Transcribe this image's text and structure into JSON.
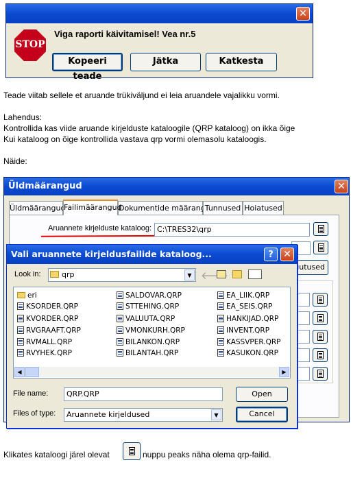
{
  "error_dialog": {
    "stop_sign_text": "STOP",
    "message": "Viga raporti käivitamisel! Vea nr.5",
    "close_symbol": "✕",
    "buttons": [
      "Kopeeri teade",
      "Jätka",
      "Katkesta"
    ]
  },
  "body_text": {
    "line1": "Teade viitab sellele et aruande trükiväljund ei leia aruandele vajalikku vormi.",
    "lahendus_heading": "Lahendus:",
    "lahendus_line1": "Kontrollida kas viide aruande kirjelduste kataloogile (QRP kataloog) on ikka õige",
    "lahendus_line2": "Kui kataloog on õige kontrollida vastava qrp vormi olemasolu kataloogis.",
    "naide": "Näide:",
    "footer_before": "Klikates kataloogi järel olevat",
    "footer_after": "nuppu  peaks näha olema qrp-failid."
  },
  "settings_window": {
    "title": "Üldmäärangud",
    "close_symbol": "✕",
    "tabs": [
      "Üldmäärangud",
      "Failimäärangud",
      "Dokumentide määrangud",
      "Tunnused",
      "Hoiatused"
    ],
    "active_tab": "Failimäärangud",
    "qrp_label": "Aruannete kirjelduste kataloog:",
    "qrp_value": "C:\\TRES32\\qrp",
    "partial_button": "gutused",
    "underline_color": "#e00000"
  },
  "file_dialog": {
    "title": "Vali aruannete kirjeldusfailide kataloog...",
    "help_symbol": "?",
    "close_symbol": "✕",
    "lookin_label": "Look in:",
    "lookin_value": "qrp",
    "folders": [
      "eri"
    ],
    "files_col1": [
      "KSORDER.QRP",
      "KVORDER.QRP",
      "RVGRAAFT.QRP",
      "RVMALL.QRP",
      "RVYHEK.QRP"
    ],
    "files_col2": [
      "SALDOVAR.QRP",
      "STTEHING.QRP",
      "VALUUTA.QRP",
      "VMONKURH.QRP",
      "BILANKON.QRP",
      "BILANTAH.QRP"
    ],
    "files_col3": [
      "EA_LIIK.QRP",
      "EA_SEIS.QRP",
      "HANKIJAD.QRP",
      "INVENT.QRP",
      "KASSVPER.QRP",
      "KASUKON.QRP"
    ],
    "filename_label": "File name:",
    "filename_value": "QRP.QRP",
    "filetype_label": "Files of type:",
    "filetype_value": "Aruannete kirjeldused",
    "open_button": "Open",
    "cancel_button": "Cancel"
  }
}
